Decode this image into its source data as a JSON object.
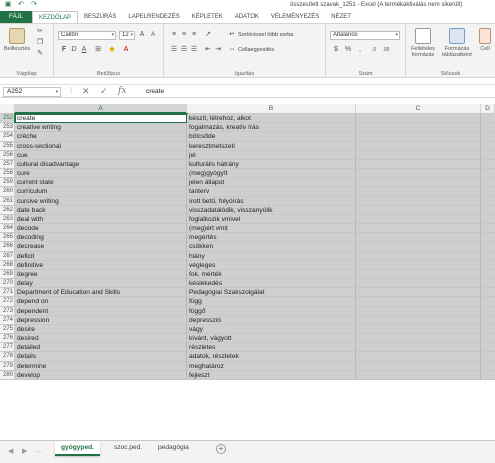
{
  "window": {
    "title": "összesített szavak_1251 - Excel (A termékaktiválás nem sikerült)",
    "qat": [
      "save-icon",
      "undo-icon",
      "redo-icon"
    ]
  },
  "ribbon_tabs": [
    "FÁJL",
    "KEZDŐLAP",
    "BESZÚRÁS",
    "LAPELRENDEZÉS",
    "KÉPLETEK",
    "ADATOK",
    "VÉLEMÉNYEZÉS",
    "NÉZET"
  ],
  "ribbon": {
    "clipboard": {
      "paste_label": "Beillesztés",
      "group_label": "Vágólap"
    },
    "font": {
      "name": "Calibri",
      "size": "12",
      "group_label": "Betűtípus",
      "bold": "F",
      "italic": "D",
      "underline": "A"
    },
    "alignment": {
      "wrap_label": "Sortöréssel több sorba",
      "merge_label": "Cellaegyesítés",
      "group_label": "Igazítás"
    },
    "number": {
      "format": "Általános",
      "group_label": "Szám"
    },
    "styles": {
      "conditional_label": "Feltételes formázás",
      "table_label": "Formázás táblázatként",
      "group_label": "Stílusok",
      "cell_label": "Cell"
    }
  },
  "formula_bar": {
    "cell_ref": "A252",
    "fx": "fx",
    "content": "create"
  },
  "columns": [
    "A",
    "B",
    "C",
    "D"
  ],
  "active_row": 252,
  "rows": [
    {
      "n": 252,
      "a": "create",
      "b": "készít, létrehoz, alkot"
    },
    {
      "n": 253,
      "a": "creative writing",
      "b": "fogalmazás, kreatív írás"
    },
    {
      "n": 254,
      "a": "crèche",
      "b": "bölcsőde"
    },
    {
      "n": 255,
      "a": "cross-sectional",
      "b": "keresztmetszeti"
    },
    {
      "n": 256,
      "a": "cue",
      "b": "jel"
    },
    {
      "n": 257,
      "a": "cultural disadvantage",
      "b": "kulturális hátrány"
    },
    {
      "n": 258,
      "a": "cure",
      "b": "(meg)gyógyít"
    },
    {
      "n": 259,
      "a": "current state",
      "b": "jelen állapot"
    },
    {
      "n": 260,
      "a": "curriculum",
      "b": "tanterv"
    },
    {
      "n": 261,
      "a": "cursive writing",
      "b": "írott betű, folyóírás"
    },
    {
      "n": 262,
      "a": "date back",
      "b": "visszadatálódik, visszanyúlik"
    },
    {
      "n": 263,
      "a": "deal with",
      "b": "foglalkozik vmivel"
    },
    {
      "n": 264,
      "a": "decode",
      "b": "(meg)ért vmit"
    },
    {
      "n": 265,
      "a": "decoding",
      "b": "megértés"
    },
    {
      "n": 266,
      "a": "decrease",
      "b": "csökken"
    },
    {
      "n": 267,
      "a": "deficit",
      "b": "hiány"
    },
    {
      "n": 268,
      "a": "definitive",
      "b": "végleges"
    },
    {
      "n": 269,
      "a": "degree",
      "b": "fok, mérték"
    },
    {
      "n": 270,
      "a": "delay",
      "b": "késlekedés"
    },
    {
      "n": 271,
      "a": "Department of Education and Skills",
      "b": "Pedagógiai Szakszolgálat"
    },
    {
      "n": 272,
      "a": "depend on",
      "b": "függ"
    },
    {
      "n": 273,
      "a": "dependent",
      "b": "függő"
    },
    {
      "n": 274,
      "a": "depression",
      "b": "depresszió"
    },
    {
      "n": 275,
      "a": "desire",
      "b": "vágy"
    },
    {
      "n": 276,
      "a": "desired",
      "b": "kívánt, vágyott"
    },
    {
      "n": 277,
      "a": "detailed",
      "b": "részletes"
    },
    {
      "n": 278,
      "a": "details",
      "b": "adatok, részletek"
    },
    {
      "n": 279,
      "a": "determine",
      "b": "meghatároz"
    },
    {
      "n": 280,
      "a": "develop",
      "b": "fejleszt"
    }
  ],
  "sheets": [
    "gyógyped.",
    "szoc.ped.",
    "pedagógia"
  ],
  "active_sheet": "gyógyped.",
  "colors": {
    "accent": "#217346",
    "selection": "#cfcfcf"
  }
}
